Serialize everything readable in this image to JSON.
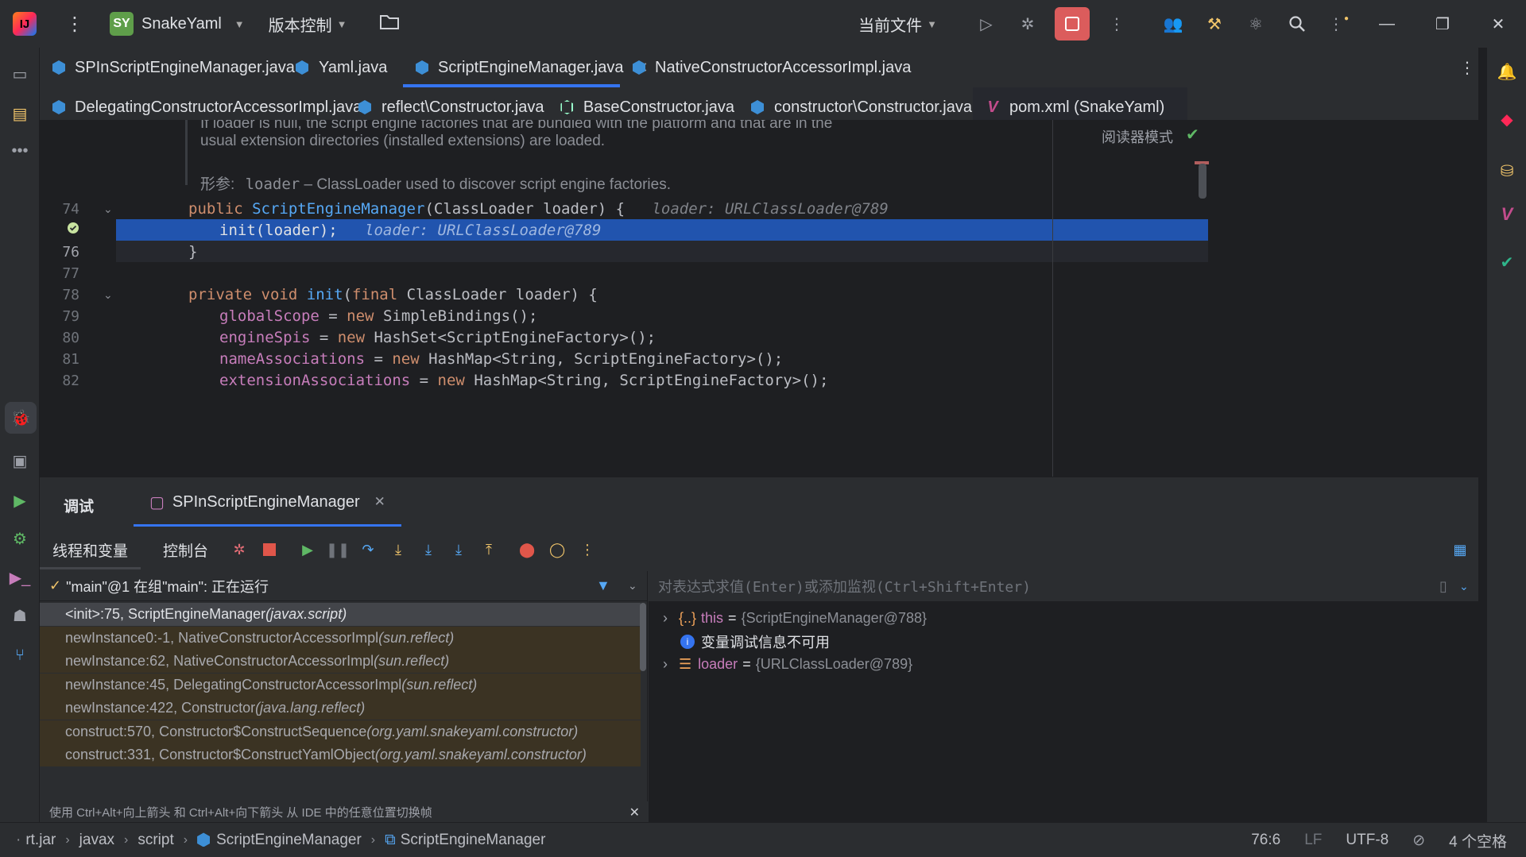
{
  "titlebar": {
    "project_badge": "SY",
    "project_name": "SnakeYaml",
    "vcs": "版本控制",
    "run_config": "当前文件"
  },
  "tabs_row1": [
    {
      "label": "SPInScriptEngineManager.java",
      "active": false
    },
    {
      "label": "Yaml.java",
      "active": false
    },
    {
      "label": "ScriptEngineManager.java",
      "active": true
    },
    {
      "label": "NativeConstructorAccessorImpl.java",
      "active": false
    }
  ],
  "tabs_row2": [
    {
      "label": "DelegatingConstructorAccessorImpl.java"
    },
    {
      "label": "reflect\\Constructor.java"
    },
    {
      "label": "BaseConstructor.java"
    },
    {
      "label": "constructor\\Constructor.java"
    },
    {
      "label": "pom.xml (SnakeYaml)"
    }
  ],
  "editor": {
    "reader_mode": "阅读器模式",
    "doc": {
      "line1": "If loader is null, the script engine factories that are bundled with the platform and that are in the",
      "line2": "usual extension directories (installed extensions) are loaded.",
      "param_label": "形参:",
      "param_name": "loader",
      "param_desc": " – ClassLoader used to discover script engine factories."
    },
    "lines": [
      {
        "num": "74",
        "code": "public ScriptEngineManager(ClassLoader loader) {",
        "hint": "loader: URLClassLoader@789"
      },
      {
        "num": "",
        "code": "init(loader);",
        "hint": "loader: URLClassLoader@789"
      },
      {
        "num": "76",
        "code": "}"
      },
      {
        "num": "77",
        "code": ""
      },
      {
        "num": "78",
        "code": "private void init(final ClassLoader loader) {"
      },
      {
        "num": "79",
        "code": "globalScope = new SimpleBindings();"
      },
      {
        "num": "80",
        "code": "engineSpis = new HashSet<ScriptEngineFactory>();"
      },
      {
        "num": "81",
        "code": "nameAssociations = new HashMap<String, ScriptEngineFactory>();"
      },
      {
        "num": "82",
        "code": "extensionAssociations = new HashMap<String, ScriptEngineFactory>();"
      }
    ]
  },
  "debug": {
    "title": "调试",
    "session_tab": "SPInScriptEngineManager",
    "subtab_threads": "线程和变量",
    "subtab_console": "控制台",
    "thread_status": "\"main\"@1 在组\"main\": 正在运行",
    "frames": [
      {
        "method": "<init>:75, ScriptEngineManager",
        "pkg": "(javax.script)"
      },
      {
        "method": "newInstance0:-1, NativeConstructorAccessorImpl",
        "pkg": "(sun.reflect)"
      },
      {
        "method": "newInstance:62, NativeConstructorAccessorImpl",
        "pkg": "(sun.reflect)"
      },
      {
        "method": "newInstance:45, DelegatingConstructorAccessorImpl",
        "pkg": "(sun.reflect)"
      },
      {
        "method": "newInstance:422, Constructor",
        "pkg": "(java.lang.reflect)"
      },
      {
        "method": "construct:570, Constructor$ConstructSequence",
        "pkg": "(org.yaml.snakeyaml.constructor)"
      },
      {
        "method": "construct:331, Constructor$ConstructYamlObject",
        "pkg": "(org.yaml.snakeyaml.constructor)"
      }
    ],
    "tip": "使用 Ctrl+Alt+向上箭头 和 Ctrl+Alt+向下箭头 从 IDE 中的任意位置切换帧",
    "eval_placeholder": "对表达式求值(Enter)或添加监视(Ctrl+Shift+Enter)",
    "vars": [
      {
        "name": "this",
        "value": "{ScriptEngineManager@788}"
      },
      {
        "info": "变量调试信息不可用"
      },
      {
        "name": "loader",
        "value": "{URLClassLoader@789}"
      }
    ]
  },
  "status": {
    "crumbs": [
      "rt.jar",
      "javax",
      "script",
      "ScriptEngineManager",
      "ScriptEngineManager"
    ],
    "position": "76:6",
    "line_sep": "LF",
    "encoding": "UTF-8",
    "indent": "4 个空格"
  },
  "colors": {
    "accent": "#3574f0",
    "exec_line": "#2154ae",
    "stop": "#db5c5c"
  }
}
